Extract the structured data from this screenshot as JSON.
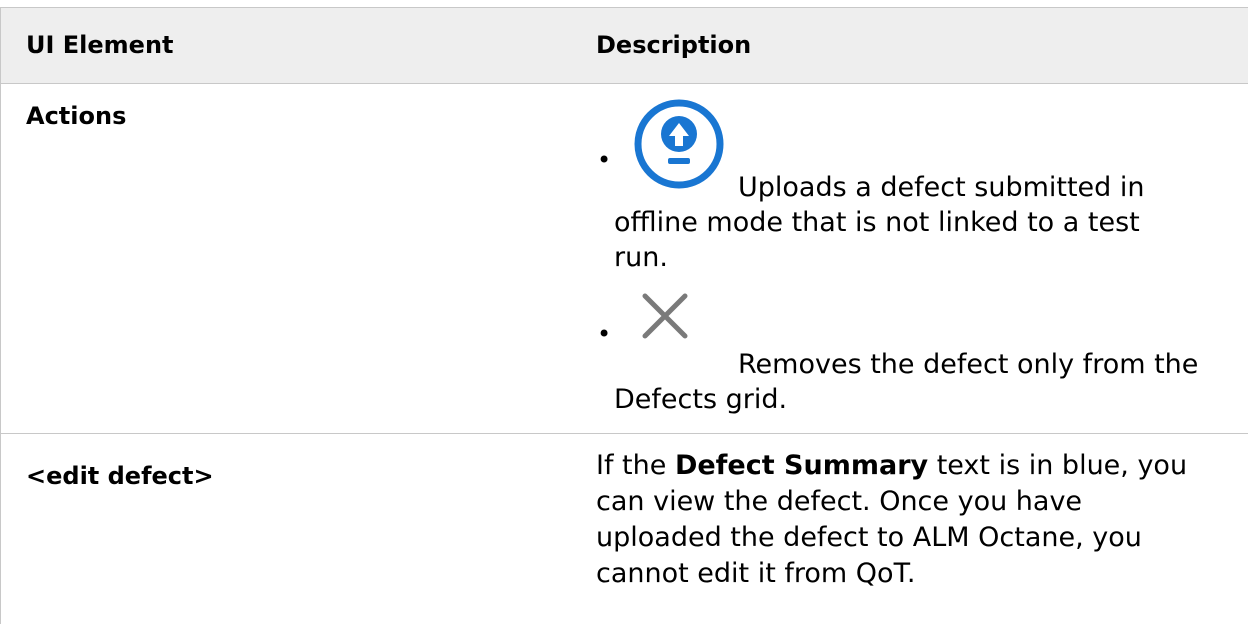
{
  "table": {
    "headers": {
      "element": "UI Element",
      "description": "Description"
    },
    "row_actions": {
      "element": "Actions",
      "items": [
        {
          "icon": "upload-icon",
          "text_line1": "Uploads a defect submitted in",
          "text_line2": "offline mode that is not linked to a test",
          "text_line3": "run."
        },
        {
          "icon": "close-icon",
          "text_line1": "Removes the defect only from the",
          "text_line2": "Defects grid."
        }
      ]
    },
    "row_edit": {
      "element": "<edit defect>",
      "desc_prefix": "If the ",
      "desc_bold": "Defect Summary",
      "desc_line1_rest": " text is in blue, you",
      "desc_line2": "can view the defect. Once you have",
      "desc_line3": "uploaded the defect to ALM Octane, you",
      "desc_line4": "cannot edit it from QoT."
    }
  },
  "colors": {
    "icon_blue": "#1976d2",
    "icon_gray": "#7a7a7a",
    "header_bg": "#eeeeee",
    "border": "#c8c8c8"
  }
}
